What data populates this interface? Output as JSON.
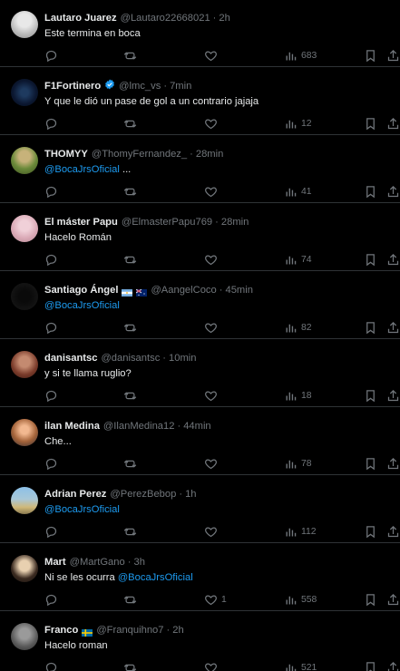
{
  "tweets": [
    {
      "name": "Lautaro Juarez",
      "handle": "@Lautaro22668021",
      "time": "2h",
      "text": "Este termina en boca",
      "mention": "",
      "after_mention": "",
      "likes": "",
      "views": "683",
      "verified": false,
      "flags": []
    },
    {
      "name": "F1Fortinero",
      "handle": "@lmc_vs",
      "time": "7min",
      "text": "Y que le dió un pase de gol a un contrario jajaja",
      "mention": "",
      "after_mention": "",
      "likes": "",
      "views": "12",
      "verified": true,
      "flags": []
    },
    {
      "name": "THOMYY",
      "handle": "@ThomyFernandez_",
      "time": "28min",
      "text": "",
      "mention": "@BocaJrsOficial",
      "after_mention": " ...",
      "likes": "",
      "views": "41",
      "verified": false,
      "flags": []
    },
    {
      "name": "El máster Papu",
      "handle": "@ElmasterPapu769",
      "time": "28min",
      "text": "Hacelo Román",
      "mention": "",
      "after_mention": "",
      "likes": "",
      "views": "74",
      "verified": false,
      "flags": []
    },
    {
      "name": "Santiago Ángel",
      "handle": "@AangelCoco",
      "time": "45min",
      "text": "",
      "mention": "@BocaJrsOficial",
      "after_mention": "",
      "likes": "",
      "views": "82",
      "verified": false,
      "flags": [
        "argentina-flag",
        "australia-flag"
      ]
    },
    {
      "name": "danisantsc",
      "handle": "@danisantsc",
      "time": "10min",
      "text": "y si te llama ruglio?",
      "mention": "",
      "after_mention": "",
      "likes": "",
      "views": "18",
      "verified": false,
      "flags": []
    },
    {
      "name": "ilan Medina",
      "handle": "@IlanMedina12",
      "time": "44min",
      "text": "Che...",
      "mention": "",
      "after_mention": "",
      "likes": "",
      "views": "78",
      "verified": false,
      "flags": []
    },
    {
      "name": "Adrian Perez",
      "handle": "@PerezBebop",
      "time": "1h",
      "text": "",
      "mention": "@BocaJrsOficial",
      "after_mention": "",
      "likes": "",
      "views": "112",
      "verified": false,
      "flags": []
    },
    {
      "name": "Mart",
      "handle": "@MartGano",
      "time": "3h",
      "text": "Ni se les ocurra ",
      "mention": "@BocaJrsOficial",
      "after_mention": "",
      "likes": "1",
      "views": "558",
      "verified": false,
      "flags": []
    },
    {
      "name": "Franco",
      "handle": "@Franquihno7",
      "time": "2h",
      "text": "Hacelo roman",
      "mention": "",
      "after_mention": "",
      "likes": "",
      "views": "521",
      "verified": false,
      "flags": [
        "sweden-flag"
      ]
    }
  ],
  "icons": {
    "reply": "reply-icon",
    "retweet": "retweet-icon",
    "like": "heart-icon",
    "views": "views-icon",
    "bookmark": "bookmark-icon",
    "share": "share-icon"
  },
  "colors": {
    "background": "#000000",
    "text": "#e7e9ea",
    "muted": "#71767b",
    "link": "#1d9bf0",
    "divider": "#2f3336",
    "verified": "#1d9bf0"
  },
  "dot": "·"
}
